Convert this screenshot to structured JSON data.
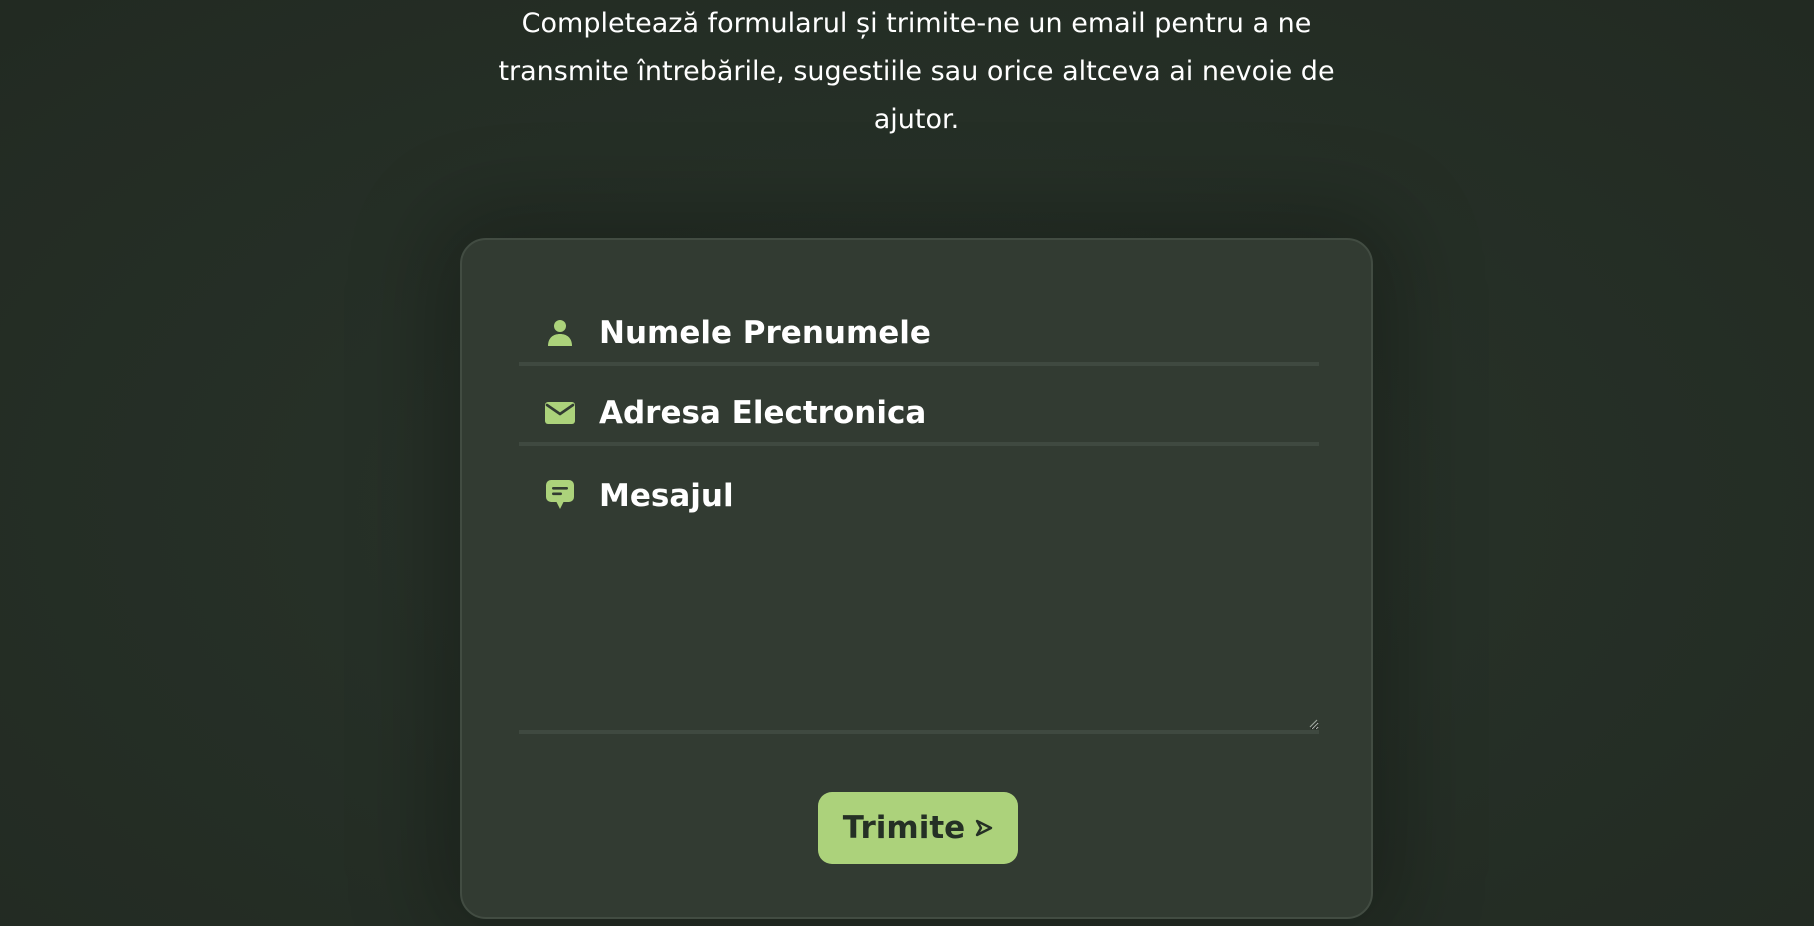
{
  "intro": {
    "text": "Completează formularul și trimite-ne un email pentru a ne transmite întrebările, sugestiile sau orice altceva ai nevoie de ajutor."
  },
  "form": {
    "name_field": {
      "placeholder": "Numele Prenumele",
      "value": "",
      "icon": "person-icon"
    },
    "email_field": {
      "placeholder": "Adresa Electronica",
      "value": "",
      "icon": "envelope-icon"
    },
    "message_field": {
      "placeholder": "Mesajul",
      "value": "",
      "icon": "message-icon"
    },
    "submit": {
      "label": "Trimite",
      "icon": "send-icon"
    }
  },
  "colors": {
    "background": "#252d25",
    "card": "#323b32",
    "accent": "#acd27b",
    "button_text": "#253025",
    "text": "#ffffff"
  }
}
